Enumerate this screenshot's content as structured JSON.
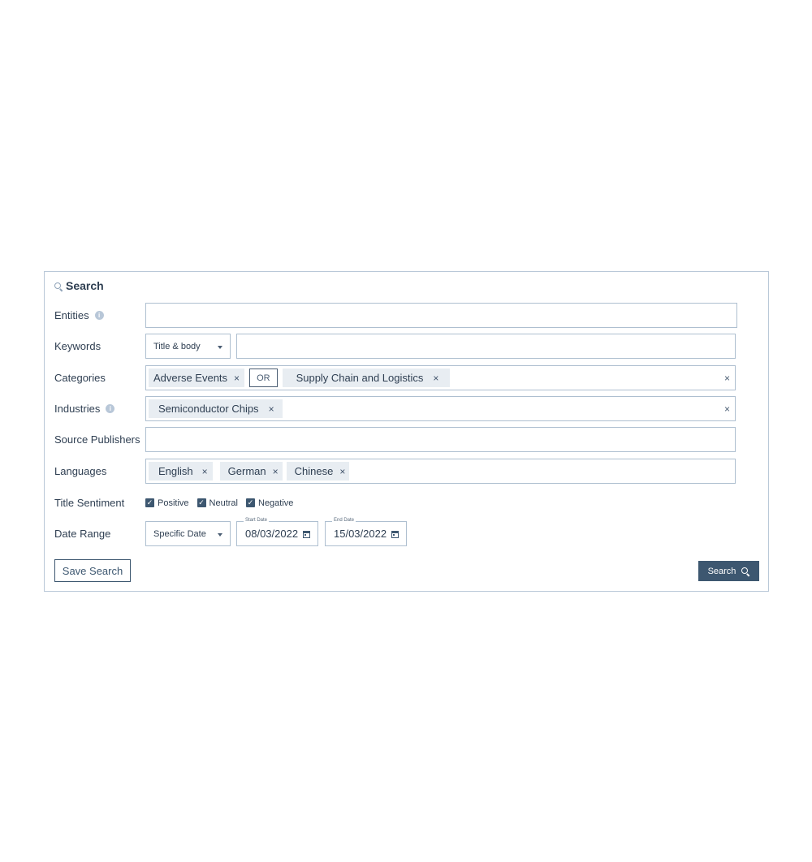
{
  "panel": {
    "title": "Search",
    "title_icon": "search-icon"
  },
  "fields": {
    "entities": {
      "label": "Entities",
      "info_icon": "info-icon",
      "value": ""
    },
    "keywords": {
      "label": "Keywords",
      "scope_selected": "Title & body",
      "value": ""
    },
    "categories": {
      "label": "Categories",
      "chips": [
        "Adverse Events",
        "Supply Chain and Logistics"
      ],
      "operator": "OR",
      "clear_icon": "×"
    },
    "industries": {
      "label": "Industries",
      "info_icon": "info-icon",
      "chips": [
        "Semiconductor Chips"
      ],
      "clear_icon": "×"
    },
    "source_publishers": {
      "label": "Source Publishers",
      "value": ""
    },
    "languages": {
      "label": "Languages",
      "chips": [
        "English",
        "German",
        "Chinese"
      ]
    },
    "title_sentiment": {
      "label": "Title Sentiment",
      "options": [
        {
          "label": "Positive",
          "checked": true
        },
        {
          "label": "Neutral",
          "checked": true
        },
        {
          "label": "Negative",
          "checked": true
        }
      ]
    },
    "date_range": {
      "label": "Date Range",
      "mode_selected": "Specific Date",
      "start_label": "Start Date",
      "start_value": "08/03/2022",
      "end_label": "End Date",
      "end_value": "15/03/2022"
    }
  },
  "actions": {
    "save_label": "Save Search",
    "search_label": "Search"
  },
  "chip_remove_glyph": "×",
  "check_glyph": "✓",
  "colors": {
    "primary": "#3d5770",
    "border": "#aebfd0",
    "chip_bg": "#e8edf2",
    "text": "#2f3f52"
  }
}
